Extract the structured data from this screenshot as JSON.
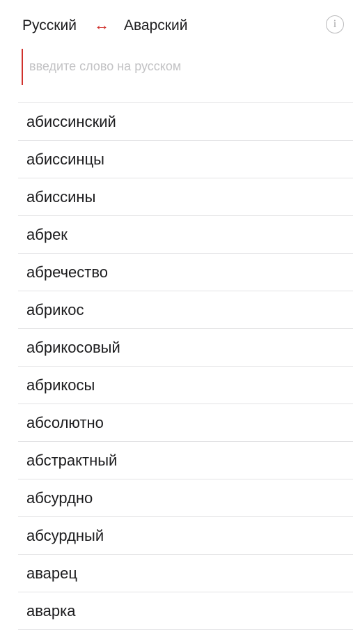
{
  "header": {
    "source_lang": "Русский",
    "swap_symbol": "↔",
    "target_lang": "Аварский",
    "info_symbol": "i"
  },
  "search": {
    "value": "",
    "placeholder": "введите слово на русском"
  },
  "colors": {
    "accent": "#d0312d",
    "divider": "#e3e3e5",
    "placeholder": "#c2c2c4"
  },
  "words": [
    "абиссинский",
    "абиссинцы",
    "абиссины",
    "абрек",
    "абречество",
    "абрикос",
    "абрикосовый",
    "абрикосы",
    "абсолютно",
    "абстрактный",
    "абсурдно",
    "абсурдный",
    "аварец",
    "аварка"
  ]
}
